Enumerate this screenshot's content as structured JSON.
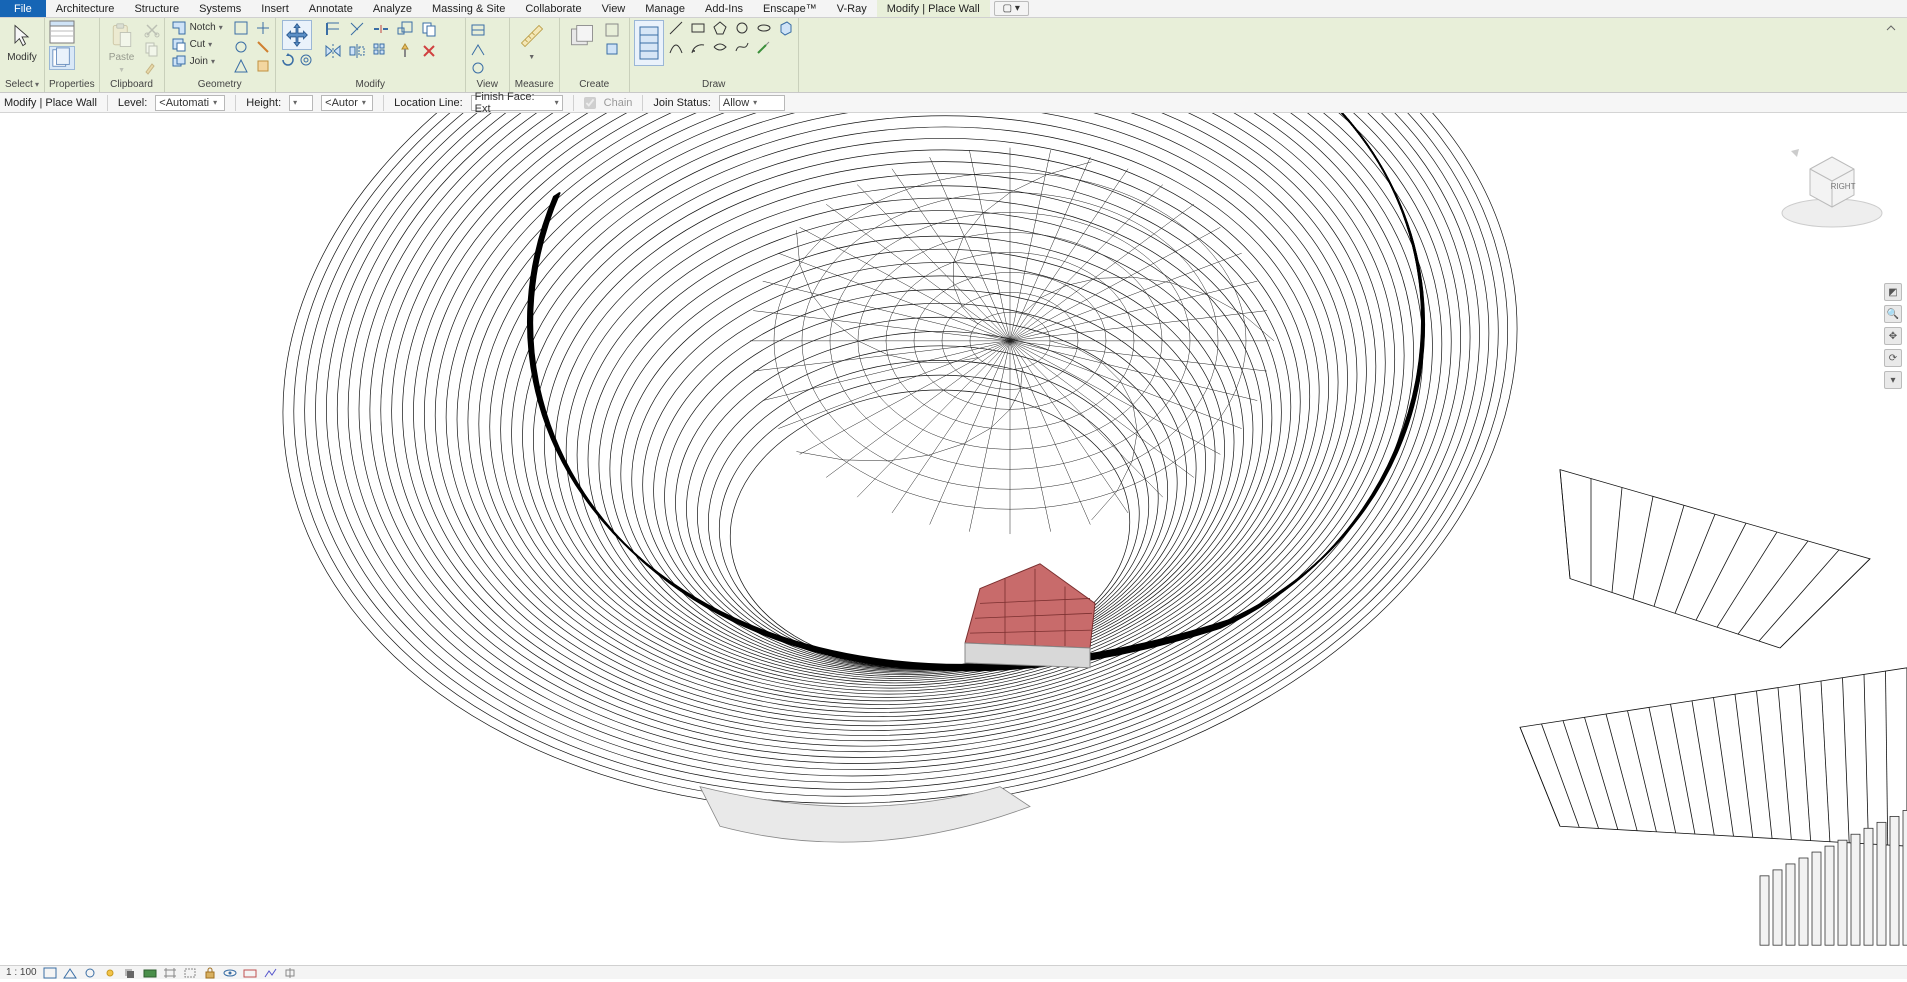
{
  "menu": {
    "file": "File",
    "tabs": [
      "Architecture",
      "Structure",
      "Systems",
      "Insert",
      "Annotate",
      "Analyze",
      "Massing & Site",
      "Collaborate",
      "View",
      "Manage",
      "Add-Ins",
      "Enscape™",
      "V-Ray",
      "Modify | Place Wall"
    ],
    "active_index": 13,
    "overflow_glyph": "▢ ▾"
  },
  "ribbon": {
    "select": {
      "label": "Select",
      "modify": "Modify"
    },
    "properties": {
      "label": "Properties"
    },
    "clipboard": {
      "label": "Clipboard",
      "paste": "Paste"
    },
    "geometry": {
      "label": "Geometry",
      "notch": "Notch",
      "cut": "Cut",
      "join": "Join"
    },
    "modify": {
      "label": "Modify"
    },
    "view": {
      "label": "View"
    },
    "measure": {
      "label": "Measure"
    },
    "create": {
      "label": "Create"
    },
    "draw": {
      "label": "Draw"
    }
  },
  "options": {
    "context": "Modify | Place Wall",
    "level_label": "Level:",
    "level_value": "<Automati",
    "height_label": "Height:",
    "height_value": "<Autor",
    "locline_label": "Location Line:",
    "locline_value": "Finish Face: Ext",
    "chain_label": "Chain",
    "chain_checked": true,
    "join_label": "Join Status:",
    "join_value": "Allow"
  },
  "viewcube": {
    "face": "RIGHT"
  },
  "status": {
    "scale": "1 : 100"
  }
}
